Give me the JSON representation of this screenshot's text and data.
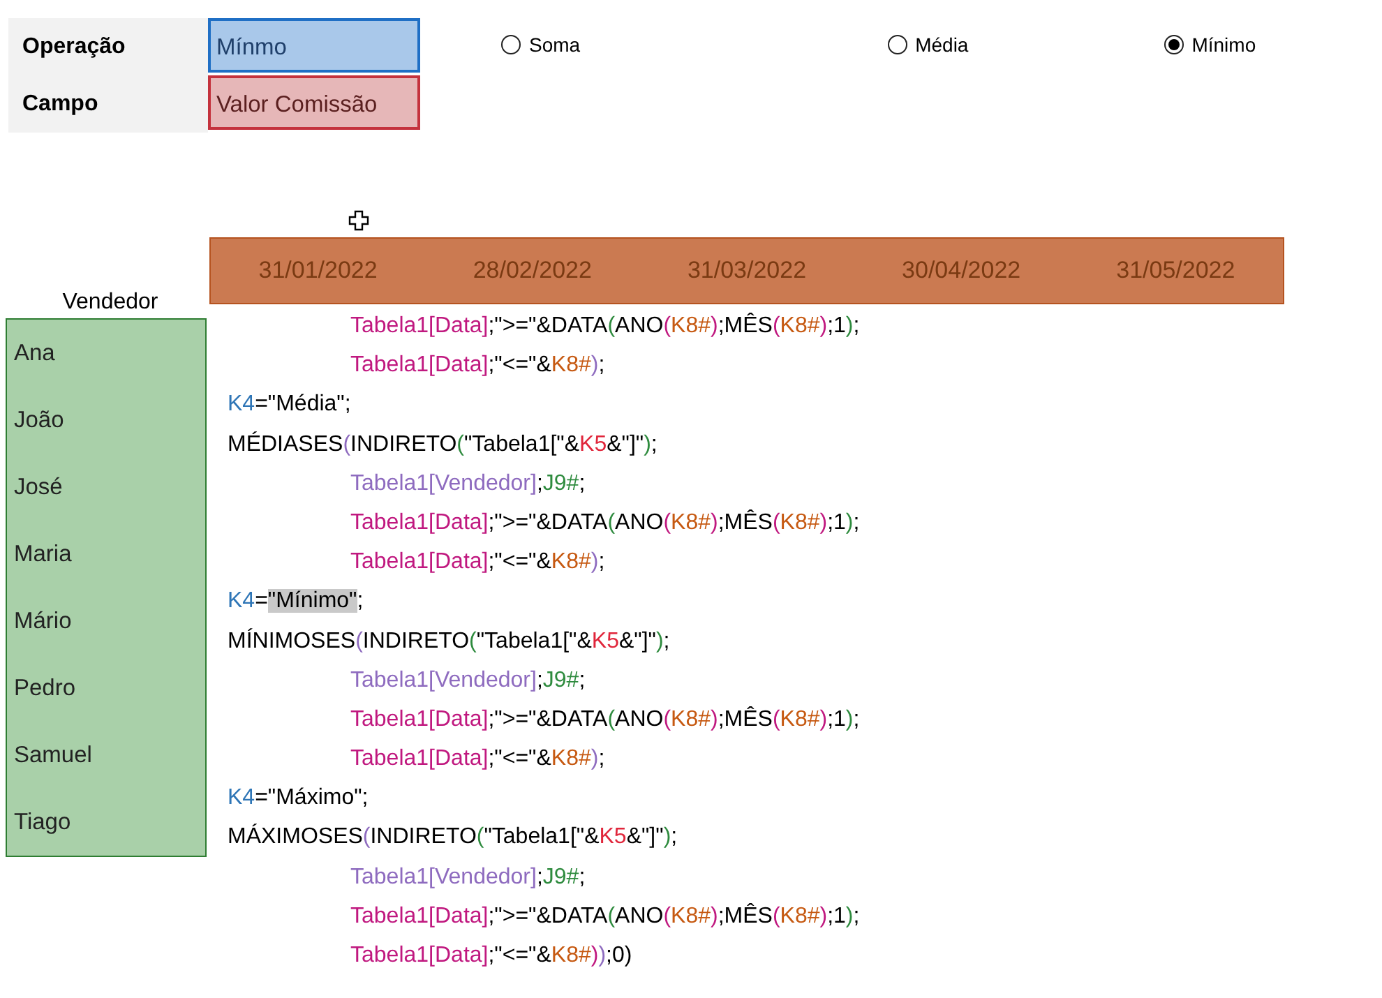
{
  "controls": {
    "fields": [
      {
        "label": "Operação",
        "value": "Mínmo",
        "kind": "operation"
      },
      {
        "label": "Campo",
        "value": "Valor Comissão",
        "kind": "field"
      }
    ],
    "options": [
      {
        "label": "Soma",
        "selected": false
      },
      {
        "label": "Média",
        "selected": false
      },
      {
        "label": "Mínimo",
        "selected": true
      }
    ]
  },
  "date_header": [
    "31/01/2022",
    "28/02/2022",
    "31/03/2022",
    "30/04/2022",
    "31/05/2022"
  ],
  "vendors": {
    "header": "Vendedor",
    "names": [
      "Ana",
      "João",
      "José",
      "Maria",
      "Mário",
      "Pedro",
      "Samuel",
      "Tiago"
    ]
  },
  "formula": [
    {
      "indented": true,
      "segments": [
        {
          "text": "Tabela1[Data]",
          "color": "#c0187f"
        },
        {
          "text": ";\">=\"&DATA",
          "color": "#000000"
        },
        {
          "text": "(",
          "color": "#2e8b3e"
        },
        {
          "text": "ANO",
          "color": "#000000"
        },
        {
          "text": "(",
          "color": "#c0187f"
        },
        {
          "text": "K8#",
          "color": "#c65911"
        },
        {
          "text": ")",
          "color": "#c0187f"
        },
        {
          "text": ";MÊS",
          "color": "#000000"
        },
        {
          "text": "(",
          "color": "#c0187f"
        },
        {
          "text": "K8#",
          "color": "#c65911"
        },
        {
          "text": ")",
          "color": "#c0187f"
        },
        {
          "text": ";1",
          "color": "#000000"
        },
        {
          "text": ")",
          "color": "#2e8b3e"
        },
        {
          "text": ";",
          "color": "#000000"
        }
      ]
    },
    {
      "indented": true,
      "segments": [
        {
          "text": "Tabela1[Data]",
          "color": "#c0187f"
        },
        {
          "text": ";\"<=\"&",
          "color": "#000000"
        },
        {
          "text": "K8#",
          "color": "#c65911"
        },
        {
          "text": ")",
          "color": "#8e6bbf"
        },
        {
          "text": ";",
          "color": "#000000"
        }
      ]
    },
    {
      "indented": false,
      "segments": [
        {
          "text": "K4",
          "color": "#2e75b6"
        },
        {
          "text": "=\"Média\";",
          "color": "#000000"
        }
      ]
    },
    {
      "indented": false,
      "segments": [
        {
          "text": "MÉDIASES",
          "color": "#000000"
        },
        {
          "text": "(",
          "color": "#8e6bbf"
        },
        {
          "text": "INDIRETO",
          "color": "#000000"
        },
        {
          "text": "(",
          "color": "#2e8b3e"
        },
        {
          "text": "\"Tabela1[\"&",
          "color": "#000000"
        },
        {
          "text": "K5",
          "color": "#e0263b"
        },
        {
          "text": "&\"]\"",
          "color": "#000000"
        },
        {
          "text": ")",
          "color": "#2e8b3e"
        },
        {
          "text": ";",
          "color": "#000000"
        }
      ]
    },
    {
      "indented": true,
      "segments": [
        {
          "text": "Tabela1[Vendedor]",
          "color": "#8e6bbf"
        },
        {
          "text": ";",
          "color": "#000000"
        },
        {
          "text": "J9#",
          "color": "#2e8b3e"
        },
        {
          "text": ";",
          "color": "#000000"
        }
      ]
    },
    {
      "indented": true,
      "segments": [
        {
          "text": "Tabela1[Data]",
          "color": "#c0187f"
        },
        {
          "text": ";\">=\"&DATA",
          "color": "#000000"
        },
        {
          "text": "(",
          "color": "#2e8b3e"
        },
        {
          "text": "ANO",
          "color": "#000000"
        },
        {
          "text": "(",
          "color": "#c0187f"
        },
        {
          "text": "K8#",
          "color": "#c65911"
        },
        {
          "text": ")",
          "color": "#c0187f"
        },
        {
          "text": ";MÊS",
          "color": "#000000"
        },
        {
          "text": "(",
          "color": "#c0187f"
        },
        {
          "text": "K8#",
          "color": "#c65911"
        },
        {
          "text": ")",
          "color": "#c0187f"
        },
        {
          "text": ";1",
          "color": "#000000"
        },
        {
          "text": ")",
          "color": "#2e8b3e"
        },
        {
          "text": ";",
          "color": "#000000"
        }
      ]
    },
    {
      "indented": true,
      "segments": [
        {
          "text": "Tabela1[Data]",
          "color": "#c0187f"
        },
        {
          "text": ";\"<=\"&",
          "color": "#000000"
        },
        {
          "text": "K8#",
          "color": "#c65911"
        },
        {
          "text": ")",
          "color": "#8e6bbf"
        },
        {
          "text": ";",
          "color": "#000000"
        }
      ]
    },
    {
      "indented": false,
      "segments": [
        {
          "text": "K4",
          "color": "#2e75b6"
        },
        {
          "text": "=",
          "color": "#000000"
        },
        {
          "text": "\"Mínimo\"",
          "color": "#000000",
          "highlighted": true
        },
        {
          "text": ";",
          "color": "#000000"
        }
      ]
    },
    {
      "indented": false,
      "segments": [
        {
          "text": "MÍNIMOSES",
          "color": "#000000"
        },
        {
          "text": "(",
          "color": "#8e6bbf"
        },
        {
          "text": "INDIRETO",
          "color": "#000000"
        },
        {
          "text": "(",
          "color": "#2e8b3e"
        },
        {
          "text": "\"Tabela1[\"&",
          "color": "#000000"
        },
        {
          "text": "K5",
          "color": "#e0263b"
        },
        {
          "text": "&\"]\"",
          "color": "#000000"
        },
        {
          "text": ")",
          "color": "#2e8b3e"
        },
        {
          "text": ";",
          "color": "#000000"
        }
      ]
    },
    {
      "indented": true,
      "segments": [
        {
          "text": "Tabela1[Vendedor]",
          "color": "#8e6bbf"
        },
        {
          "text": ";",
          "color": "#000000"
        },
        {
          "text": "J9#",
          "color": "#2e8b3e"
        },
        {
          "text": ";",
          "color": "#000000"
        }
      ]
    },
    {
      "indented": true,
      "segments": [
        {
          "text": "Tabela1[Data]",
          "color": "#c0187f"
        },
        {
          "text": ";\">=\"&DATA",
          "color": "#000000"
        },
        {
          "text": "(",
          "color": "#2e8b3e"
        },
        {
          "text": "ANO",
          "color": "#000000"
        },
        {
          "text": "(",
          "color": "#c0187f"
        },
        {
          "text": "K8#",
          "color": "#c65911"
        },
        {
          "text": ")",
          "color": "#c0187f"
        },
        {
          "text": ";MÊS",
          "color": "#000000"
        },
        {
          "text": "(",
          "color": "#c0187f"
        },
        {
          "text": "K8#",
          "color": "#c65911"
        },
        {
          "text": ")",
          "color": "#c0187f"
        },
        {
          "text": ";1",
          "color": "#000000"
        },
        {
          "text": ")",
          "color": "#2e8b3e"
        },
        {
          "text": ";",
          "color": "#000000"
        }
      ]
    },
    {
      "indented": true,
      "segments": [
        {
          "text": "Tabela1[Data]",
          "color": "#c0187f"
        },
        {
          "text": ";\"<=\"&",
          "color": "#000000"
        },
        {
          "text": "K8#",
          "color": "#c65911"
        },
        {
          "text": ")",
          "color": "#8e6bbf"
        },
        {
          "text": ";",
          "color": "#000000"
        }
      ]
    },
    {
      "indented": false,
      "segments": [
        {
          "text": "K4",
          "color": "#2e75b6"
        },
        {
          "text": "=\"Máximo\";",
          "color": "#000000"
        }
      ]
    },
    {
      "indented": false,
      "segments": [
        {
          "text": "MÁXIMOSES",
          "color": "#000000"
        },
        {
          "text": "(",
          "color": "#8e6bbf"
        },
        {
          "text": "INDIRETO",
          "color": "#000000"
        },
        {
          "text": "(",
          "color": "#2e8b3e"
        },
        {
          "text": "\"Tabela1[\"&",
          "color": "#000000"
        },
        {
          "text": "K5",
          "color": "#e0263b"
        },
        {
          "text": "&\"]\"",
          "color": "#000000"
        },
        {
          "text": ")",
          "color": "#2e8b3e"
        },
        {
          "text": ";",
          "color": "#000000"
        }
      ]
    },
    {
      "indented": true,
      "segments": [
        {
          "text": "Tabela1[Vendedor]",
          "color": "#8e6bbf"
        },
        {
          "text": ";",
          "color": "#000000"
        },
        {
          "text": "J9#",
          "color": "#2e8b3e"
        },
        {
          "text": ";",
          "color": "#000000"
        }
      ]
    },
    {
      "indented": true,
      "segments": [
        {
          "text": "Tabela1[Data]",
          "color": "#c0187f"
        },
        {
          "text": ";\">=\"&DATA",
          "color": "#000000"
        },
        {
          "text": "(",
          "color": "#2e8b3e"
        },
        {
          "text": "ANO",
          "color": "#000000"
        },
        {
          "text": "(",
          "color": "#c0187f"
        },
        {
          "text": "K8#",
          "color": "#c65911"
        },
        {
          "text": ")",
          "color": "#c0187f"
        },
        {
          "text": ";MÊS",
          "color": "#000000"
        },
        {
          "text": "(",
          "color": "#c0187f"
        },
        {
          "text": "K8#",
          "color": "#c65911"
        },
        {
          "text": ")",
          "color": "#c0187f"
        },
        {
          "text": ";1",
          "color": "#000000"
        },
        {
          "text": ")",
          "color": "#2e8b3e"
        },
        {
          "text": ";",
          "color": "#000000"
        }
      ]
    },
    {
      "indented": true,
      "segments": [
        {
          "text": "Tabela1[Data]",
          "color": "#c0187f"
        },
        {
          "text": ";\"<=\"&",
          "color": "#000000"
        },
        {
          "text": "K8#",
          "color": "#c65911"
        },
        {
          "text": ")",
          "color": "#c0187f"
        },
        {
          "text": ")",
          "color": "#8e6bbf"
        },
        {
          "text": ";0)",
          "color": "#000000"
        }
      ]
    }
  ]
}
